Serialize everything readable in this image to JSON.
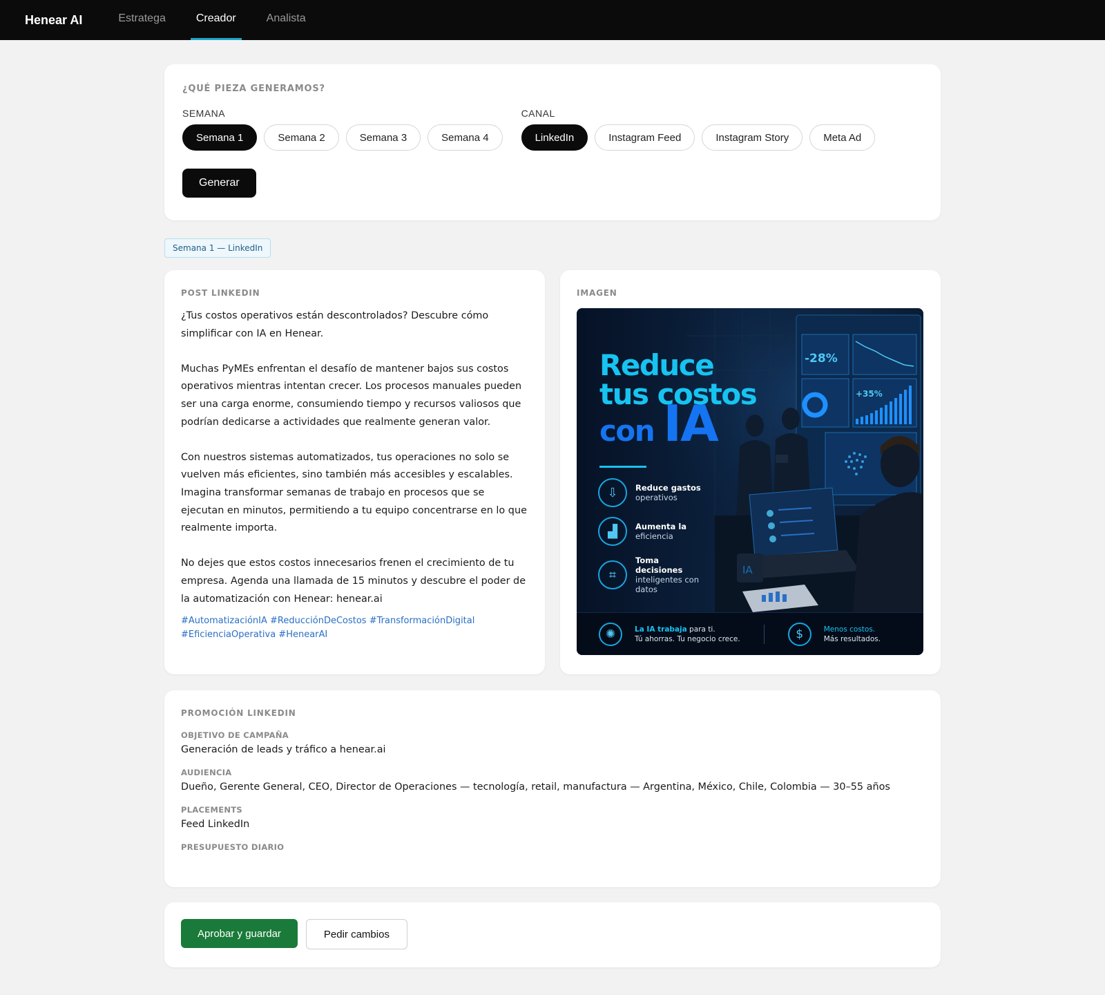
{
  "nav": {
    "brand": "Henear AI",
    "tabs": [
      {
        "label": "Estratega",
        "active": false
      },
      {
        "label": "Creador",
        "active": true
      },
      {
        "label": "Analista",
        "active": false
      }
    ]
  },
  "generator": {
    "title": "¿QUÉ PIEZA GENERAMOS?",
    "week_label": "SEMANA",
    "weeks": [
      "Semana 1",
      "Semana 2",
      "Semana 3",
      "Semana 4"
    ],
    "selected_week": "Semana 1",
    "channel_label": "CANAL",
    "channels": [
      "LinkedIn",
      "Instagram Feed",
      "Instagram Story",
      "Meta Ad"
    ],
    "selected_channel": "LinkedIn",
    "generate_label": "Generar"
  },
  "context_tag": "Semana 1 — LinkedIn",
  "post": {
    "title": "POST LINKEDIN",
    "paragraphs": [
      "¿Tus costos operativos están descontrolados? Descubre cómo simplificar con IA en Henear.",
      "Muchas PyMEs enfrentan el desafío de mantener bajos sus costos operativos mientras intentan crecer. Los procesos manuales pueden ser una carga enorme, consumiendo tiempo y recursos valiosos que podrían dedicarse a actividades que realmente generan valor.",
      "Con nuestros sistemas automatizados, tus operaciones no solo se vuelven más eficientes, sino también más accesibles y escalables. Imagina transformar semanas de trabajo en procesos que se ejecutan en minutos, permitiendo a tu equipo concentrarse en lo que realmente importa.",
      "No dejes que estos costos innecesarios frenen el crecimiento de tu empresa. Agenda una llamada de 15 minutos y descubre el poder de la automatización con Henear: henear.ai"
    ],
    "hashtags_line1": "#AutomatizaciónIA #ReducciónDeCostos #TransformaciónDigital",
    "hashtags_line2": "#EficienciaOperativa #HenearAI"
  },
  "image": {
    "title": "IMAGEN",
    "headline_1": "Reduce",
    "headline_2": "tus costos",
    "headline_3a": "con",
    "headline_3b": "IA",
    "dashboard_stat_1": "-28%",
    "dashboard_stat_2": "+35%",
    "screen_badge": "IA",
    "benefits": [
      {
        "icon": "arrow-down-coin-icon",
        "bold": "Reduce gastos",
        "text": "operativos"
      },
      {
        "icon": "growth-chart-icon",
        "bold": "Aumenta la",
        "text": "eficiencia"
      },
      {
        "icon": "chip-icon",
        "bold": "Toma decisiones",
        "text": "inteligentes con datos"
      }
    ],
    "footer_left_highlight": "La IA trabaja",
    "footer_left_rest": "para ti.",
    "footer_left_line2": "Tú ahorras. Tu negocio crece.",
    "footer_right_line1": "Menos costos.",
    "footer_right_line2": "Más resultados."
  },
  "promotion": {
    "title": "PROMOCIÓN LINKEDIN",
    "objective_label": "OBJETIVO DE CAMPAÑA",
    "objective": "Generación de leads y tráfico a henear.ai",
    "audience_label": "AUDIENCIA",
    "audience": "Dueño, Gerente General, CEO, Director de Operaciones — tecnología, retail, manufactura — Argentina, México, Chile, Colombia — 30–55 años",
    "placements_label": "PLACEMENTS",
    "placements": "Feed LinkedIn",
    "budget_label": "PRESUPUESTO DIARIO"
  },
  "actions": {
    "approve_label": "Aprobar y guardar",
    "changes_label": "Pedir cambios"
  },
  "colors": {
    "accent_tab": "#19a7c9",
    "approve": "#1a7a3a",
    "hashtag": "#2a6fc4"
  }
}
